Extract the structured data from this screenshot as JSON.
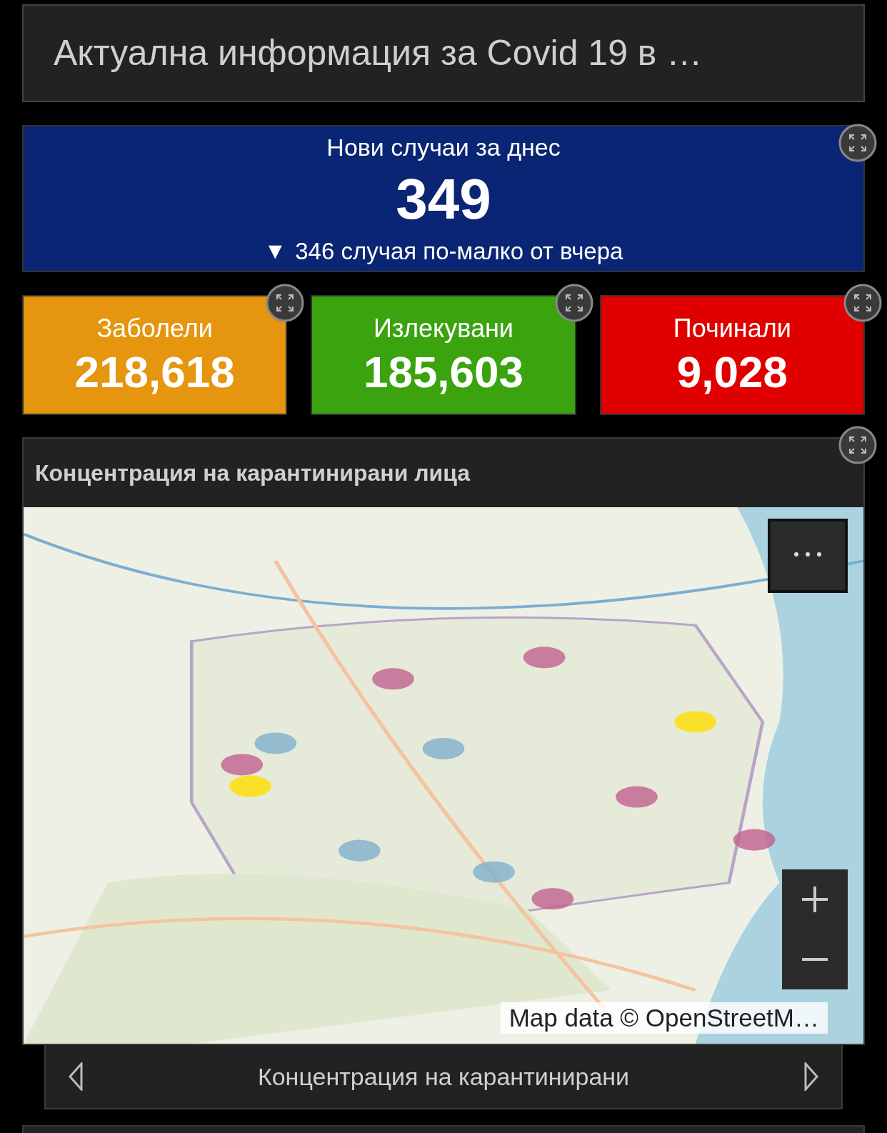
{
  "header": {
    "title": "Актуална информация за Covid 19 в …"
  },
  "headline": {
    "label": "Нови случаи за днес",
    "value": "349",
    "change_icon": "▼",
    "change": "346 случая по-малко от вчера"
  },
  "stats": [
    {
      "label": "Заболели",
      "value": "218,618",
      "color": "#e5950e"
    },
    {
      "label": "Излекувани",
      "value": "185,603",
      "color": "#3aa30e"
    },
    {
      "label": "Починали",
      "value": "9,028",
      "color": "#e00000"
    }
  ],
  "map_panel": {
    "title": "Концентрация на карантинирани лица",
    "attribution": "Map data © OpenStreetM…"
  },
  "nav": {
    "label": "Концентрация на карантинирани"
  }
}
